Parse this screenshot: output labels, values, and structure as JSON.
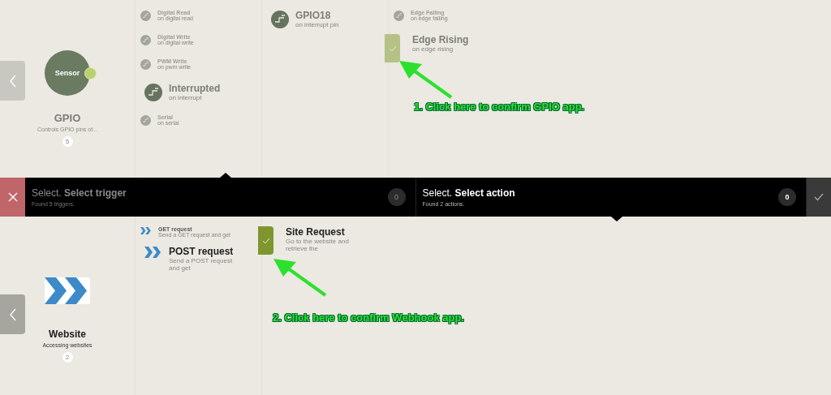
{
  "trigger": {
    "app": {
      "name": "GPIO",
      "description": "Controls GPIO pins of...",
      "count": "5",
      "icon_label": "Sensor",
      "kind": "sensor"
    },
    "columns": [
      {
        "items": [
          {
            "title": "Digital Read",
            "subtitle": "on digital read",
            "selected": false
          },
          {
            "title": "Digital Write",
            "subtitle": "on digital write",
            "selected": false
          },
          {
            "title": "PWM Write",
            "subtitle": "on pwm write",
            "selected": false
          },
          {
            "title": "Interrupted",
            "subtitle": "on interrupt",
            "selected": true
          },
          {
            "title": "Serial",
            "subtitle": "on serial",
            "selected": false
          }
        ]
      },
      {
        "items": [
          {
            "title": "GPIO18",
            "subtitle": "on interrupt pin",
            "selected": true
          }
        ]
      },
      {
        "confirm_active": false,
        "items": [
          {
            "title": "Edge Falling",
            "subtitle": "on edge falling",
            "selected": false
          },
          {
            "title": "Edge Rising",
            "subtitle": "on edge rising",
            "selected": true
          }
        ]
      }
    ],
    "annotation": "1. Click here to confirm GPIO app."
  },
  "bar": {
    "sections": [
      {
        "prefix": "Select.",
        "title": "Select trigger",
        "found": "Found 5 triggers.",
        "count": "0",
        "active": false
      },
      {
        "prefix": "Select.",
        "title": "Select action",
        "found": "Found 2 actions.",
        "count": "0",
        "active": true
      }
    ]
  },
  "action": {
    "app": {
      "name": "Website",
      "description": "Accessing websites",
      "count": "2",
      "kind": "chevrons"
    },
    "columns": [
      {
        "items": [
          {
            "title": "GET request",
            "subtitle": "Send a GET request and get",
            "selected": false
          },
          {
            "title": "POST request",
            "subtitle": "Send a POST request and get",
            "selected": true
          }
        ]
      },
      {
        "confirm_active": true,
        "items": [
          {
            "title": "Site Request",
            "subtitle": "Go to the website and retrieve the",
            "selected": true
          }
        ]
      }
    ],
    "annotation": "2. Click here to confirm Webhook app."
  }
}
